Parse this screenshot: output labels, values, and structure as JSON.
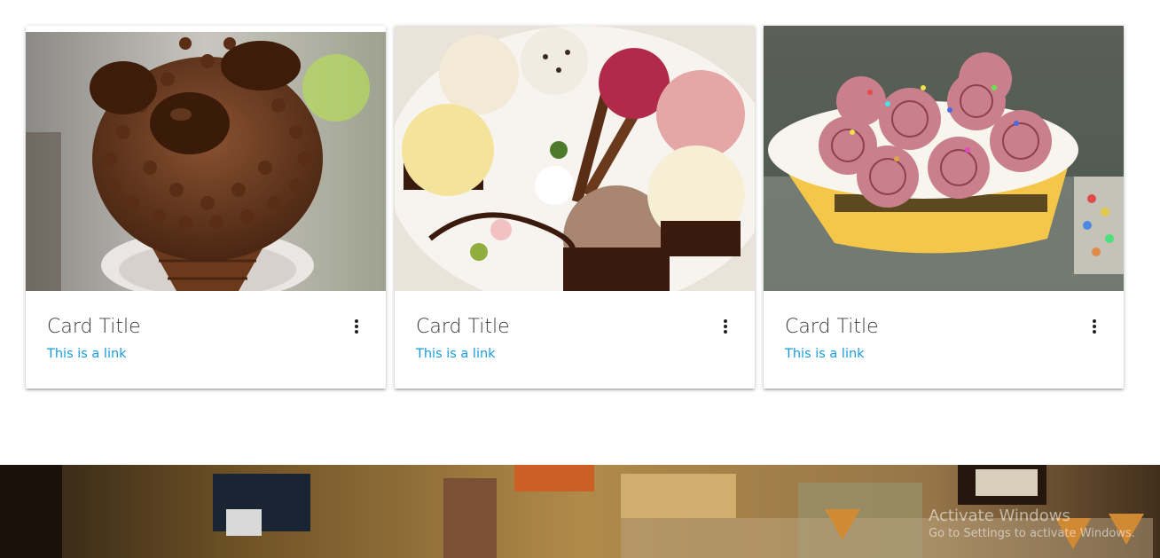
{
  "cards": [
    {
      "title": "Card Title",
      "link": "This is a link",
      "image": "chocolate-ice-cream-cone"
    },
    {
      "title": "Card Title",
      "link": "This is a link",
      "image": "ice-cream-scoops-plate"
    },
    {
      "title": "Card Title",
      "link": "This is a link",
      "image": "rolled-ice-cream-cup"
    }
  ],
  "banner": {
    "image": "ice-cream-shop-interior"
  },
  "watermark": {
    "title": "Activate Windows",
    "subtitle": "Go to Settings to activate Windows."
  },
  "colors": {
    "link": "#1a9be0",
    "title": "#3a3a3a"
  }
}
